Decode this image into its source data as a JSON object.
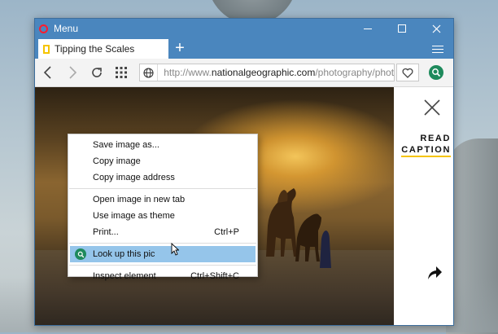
{
  "window": {
    "menu_label": "Menu"
  },
  "tab": {
    "title": "Tipping the Scales",
    "new_tab_symbol": "+"
  },
  "address_bar": {
    "url_prefix": "http://www.",
    "url_domain": "nationalgeographic.com",
    "url_rest": "/photography/photo-"
  },
  "side_panel": {
    "read_label": "READ",
    "caption_label": "CAPTION"
  },
  "context_menu": {
    "items": [
      {
        "label": "Save image as...",
        "shortcut": ""
      },
      {
        "label": "Copy image",
        "shortcut": ""
      },
      {
        "label": "Copy image address",
        "shortcut": ""
      },
      {
        "label": "Open image in new tab",
        "shortcut": ""
      },
      {
        "label": "Use image as theme",
        "shortcut": ""
      },
      {
        "label": "Print...",
        "shortcut": "Ctrl+P"
      },
      {
        "label": "Look up this pic",
        "shortcut": ""
      },
      {
        "label": "Inspect element",
        "shortcut": "Ctrl+Shift+C"
      }
    ],
    "highlighted_index": 6
  },
  "colors": {
    "titlebar": "#4a86be",
    "opera_red": "#ff1b2d",
    "tab_favicon": "#f5c400",
    "extension_green": "#1e8a5c",
    "menu_highlight": "#95c5ea"
  },
  "icons": {
    "back": "back-arrow-icon",
    "forward": "forward-arrow-icon",
    "reload": "reload-icon",
    "speed_dial": "grid-icon",
    "site_info": "globe-icon",
    "bookmark": "heart-icon",
    "extension": "search-extension-icon",
    "close_panel": "close-icon",
    "share": "share-icon"
  }
}
